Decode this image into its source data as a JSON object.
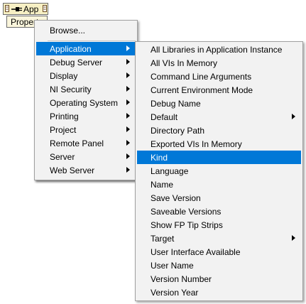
{
  "node": {
    "header_label": "App",
    "property_label": "Property"
  },
  "menu1": {
    "browse_label": "Browse..."
  },
  "menu2": {
    "items": [
      {
        "label": "Application",
        "submenu": true
      },
      {
        "label": "Debug Server",
        "submenu": true
      },
      {
        "label": "Display",
        "submenu": true
      },
      {
        "label": "NI Security",
        "submenu": true
      },
      {
        "label": "Operating System",
        "submenu": true
      },
      {
        "label": "Printing",
        "submenu": true
      },
      {
        "label": "Project",
        "submenu": true
      },
      {
        "label": "Remote Panel",
        "submenu": true
      },
      {
        "label": "Server",
        "submenu": true
      },
      {
        "label": "Web Server",
        "submenu": true
      }
    ],
    "selected": "Application"
  },
  "menu3": {
    "items": [
      {
        "label": "All Libraries in Application Instance",
        "submenu": false
      },
      {
        "label": "All VIs In Memory",
        "submenu": false
      },
      {
        "label": "Command Line Arguments",
        "submenu": false
      },
      {
        "label": "Current Environment Mode",
        "submenu": false
      },
      {
        "label": "Debug Name",
        "submenu": false
      },
      {
        "label": "Default",
        "submenu": true
      },
      {
        "label": "Directory Path",
        "submenu": false
      },
      {
        "label": "Exported VIs In Memory",
        "submenu": false
      },
      {
        "label": "Kind",
        "submenu": false
      },
      {
        "label": "Language",
        "submenu": false
      },
      {
        "label": "Name",
        "submenu": false
      },
      {
        "label": "Save Version",
        "submenu": false
      },
      {
        "label": "Saveable Versions",
        "submenu": false
      },
      {
        "label": "Show FP Tip Strips",
        "submenu": false
      },
      {
        "label": "Target",
        "submenu": true
      },
      {
        "label": "User Interface Available",
        "submenu": false
      },
      {
        "label": "User Name",
        "submenu": false
      },
      {
        "label": "Version Number",
        "submenu": false
      },
      {
        "label": "Version Year",
        "submenu": false
      }
    ],
    "selected": "Kind"
  },
  "colors": {
    "highlight": "#0078d7",
    "menu_bg": "#f2f2f2",
    "node_bg": "#f7f0c4"
  }
}
